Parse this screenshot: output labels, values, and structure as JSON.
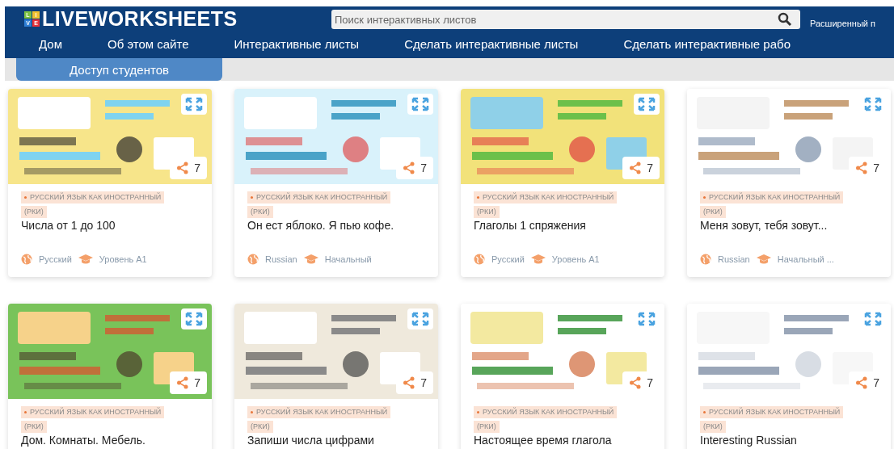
{
  "logo": {
    "badge_letters": [
      "L",
      "I",
      "V",
      "E"
    ],
    "name": "LIVEWORKSHEETS"
  },
  "search": {
    "placeholder": "Поиск интерактивных листов"
  },
  "advanced_search": "Расширенный п",
  "nav": [
    "Дом",
    "Об этом сайте",
    "Интерактивные листы",
    "Сделать интерактивные листы",
    "Сделать интерактивные рабо"
  ],
  "student_tab": "Доступ студентов",
  "cards": [
    {
      "tag": "РУССКИЙ ЯЗЫК КАК ИНОСТРАННЫЙ",
      "tag_abbr": "(РКИ)",
      "title": "Числа от 1 до 100",
      "shares": "7",
      "language": "Русский",
      "level": "Уровень А1"
    },
    {
      "tag": "РУССКИЙ ЯЗЫК КАК ИНОСТРАННЫЙ",
      "tag_abbr": "(РКИ)",
      "title": "Он ест яблоко. Я пью кофе.",
      "shares": "7",
      "language": "Russian",
      "level": "Начальный"
    },
    {
      "tag": "РУССКИЙ ЯЗЫК КАК ИНОСТРАННЫЙ",
      "tag_abbr": "(РКИ)",
      "title": "Глаголы 1 спряжения",
      "shares": "7",
      "language": "Русский",
      "level": "Уровень А1"
    },
    {
      "tag": "РУССКИЙ ЯЗЫК КАК ИНОСТРАННЫЙ",
      "tag_abbr": "(РКИ)",
      "title": "Меня зовут, тебя зовут...",
      "shares": "7",
      "language": "Russian",
      "level": "Начальный ..."
    },
    {
      "tag": "РУССКИЙ ЯЗЫК КАК ИНОСТРАННЫЙ",
      "tag_abbr": "(РКИ)",
      "title": "Дом. Комнаты. Мебель.",
      "shares": "7"
    },
    {
      "tag": "РУССКИЙ ЯЗЫК КАК ИНОСТРАННЫЙ",
      "tag_abbr": "(РКИ)",
      "title": "Запиши числа цифрами",
      "shares": "7"
    },
    {
      "tag": "РУССКИЙ ЯЗЫК КАК ИНОСТРАННЫЙ",
      "tag_abbr": "(РКИ)",
      "title": "Настоящее время глагола",
      "shares": "7"
    },
    {
      "tag": "РУССКИЙ ЯЗЫК КАК ИНОСТРАННЫЙ",
      "tag_abbr": "(РКИ)",
      "title": "Interesting Russian",
      "shares": "7"
    }
  ]
}
